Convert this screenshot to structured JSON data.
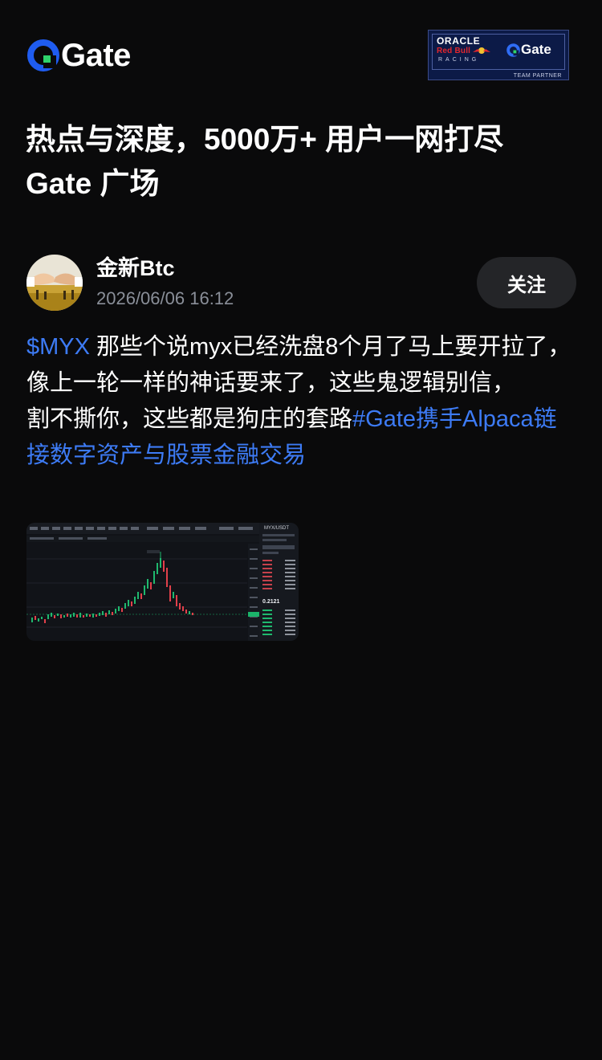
{
  "brand": {
    "logo_text": "Gate",
    "accent_color": "#1f5cf0",
    "logo_icon": "gate-logo-icon"
  },
  "partner_badge": {
    "oracle": "ORACLE",
    "redbull": "Red Bull",
    "racing": "RACING",
    "gate": "Gate",
    "team_partner": "TEAM PARTNER"
  },
  "headline": {
    "line1": "热点与深度，5000万+ 用户一网打尽",
    "line2": "Gate 广场"
  },
  "post": {
    "author": "金新Btc",
    "timestamp": "2026/06/06 16:12",
    "follow_label": "关注",
    "ticker": "$MYX",
    "text1": " 那些个说myx已经洗盘8个月了马上要开拉了，",
    "text2": "像上一轮一样的神话要来了，这些鬼逻辑别信，",
    "text3": "割不撕你，这些都是狗庄的套路",
    "hashtag": "#Gate携手Alpaca链接数字资产与股票金融交易",
    "link_color": "#3d7bf5"
  },
  "attachment": {
    "pair_label": "MYX/USDT",
    "price_label": "0.2121"
  }
}
